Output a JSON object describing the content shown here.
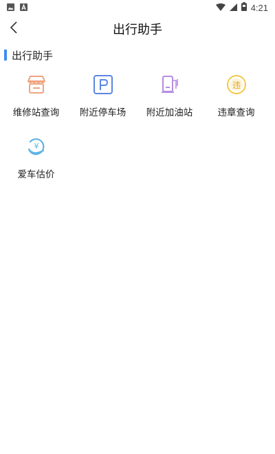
{
  "status_bar": {
    "time": "4:21"
  },
  "header": {
    "title": "出行助手"
  },
  "section": {
    "title": "出行助手",
    "accent_color": "#3b8df0"
  },
  "items": [
    {
      "label": "维修站查询",
      "icon": "shop-icon",
      "color": "#f0a37e"
    },
    {
      "label": "附近停车场",
      "icon": "parking-icon",
      "color": "#5b86e0"
    },
    {
      "label": "附近加油站",
      "icon": "gas-station-icon",
      "color": "#b58be0"
    },
    {
      "label": "违章查询",
      "icon": "violation-icon",
      "color": "#f2c84b"
    },
    {
      "label": "爱车估价",
      "icon": "car-valuation-icon",
      "color": "#5fb3e6"
    }
  ]
}
